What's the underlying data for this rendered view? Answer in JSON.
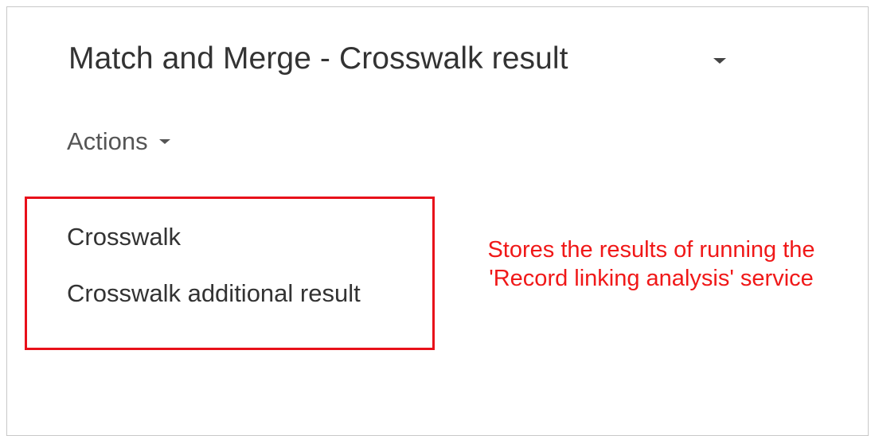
{
  "header": {
    "title": "Match and Merge - Crosswalk result",
    "title_dropdown_icon": "chevron-down-icon"
  },
  "actions": {
    "label": "Actions",
    "dropdown_icon": "chevron-down-icon"
  },
  "menu": {
    "items": [
      {
        "label": "Crosswalk"
      },
      {
        "label": "Crosswalk additional result"
      }
    ]
  },
  "annotation": {
    "line1": "Stores the results of running the",
    "line2": "'Record linking analysis' service"
  },
  "colors": {
    "annotation": "#f01818",
    "highlight_border": "#e8101a",
    "text_primary": "#333333",
    "text_secondary": "#555555",
    "frame_border": "#c8c8c8"
  }
}
